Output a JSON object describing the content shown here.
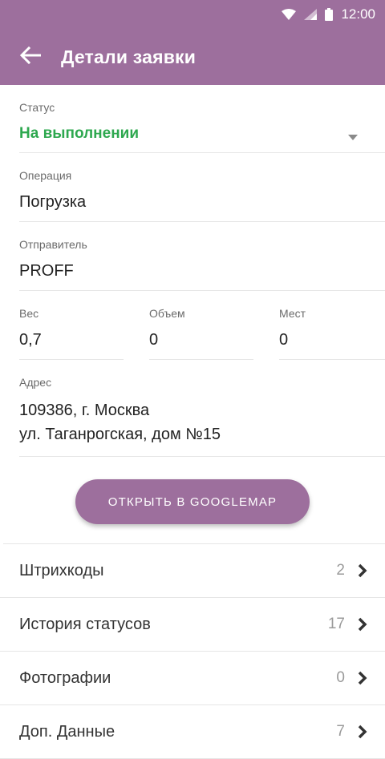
{
  "statusbar": {
    "time": "12:00"
  },
  "appbar": {
    "title": "Детали заявки"
  },
  "fields": {
    "status": {
      "label": "Статус",
      "value": "На выполнении"
    },
    "operation": {
      "label": "Операция",
      "value": "Погрузка"
    },
    "sender": {
      "label": "Отправитель",
      "value": "PROFF"
    },
    "weight": {
      "label": "Вес",
      "value": "0,7"
    },
    "volume": {
      "label": "Объем",
      "value": "0"
    },
    "places": {
      "label": "Мест",
      "value": "0"
    },
    "address": {
      "label": "Адрес",
      "line1": "109386, г. Москва",
      "line2": "ул. Таганрогская, дом №15"
    }
  },
  "button": {
    "label": "ОТКРЫТЬ В GOOGLEMAP"
  },
  "list": [
    {
      "label": "Штрихкоды",
      "count": "2"
    },
    {
      "label": "История статусов",
      "count": "17"
    },
    {
      "label": "Фотографии",
      "count": "0"
    },
    {
      "label": "Доп. Данные",
      "count": "7"
    }
  ],
  "colors": {
    "primary": "#9d6f9d",
    "status_green": "#2ea84f"
  },
  "icons": [
    "wifi-icon",
    "signal-icon",
    "battery-icon",
    "back-arrow-icon",
    "dropdown-arrow-icon",
    "chevron-right-icon"
  ]
}
